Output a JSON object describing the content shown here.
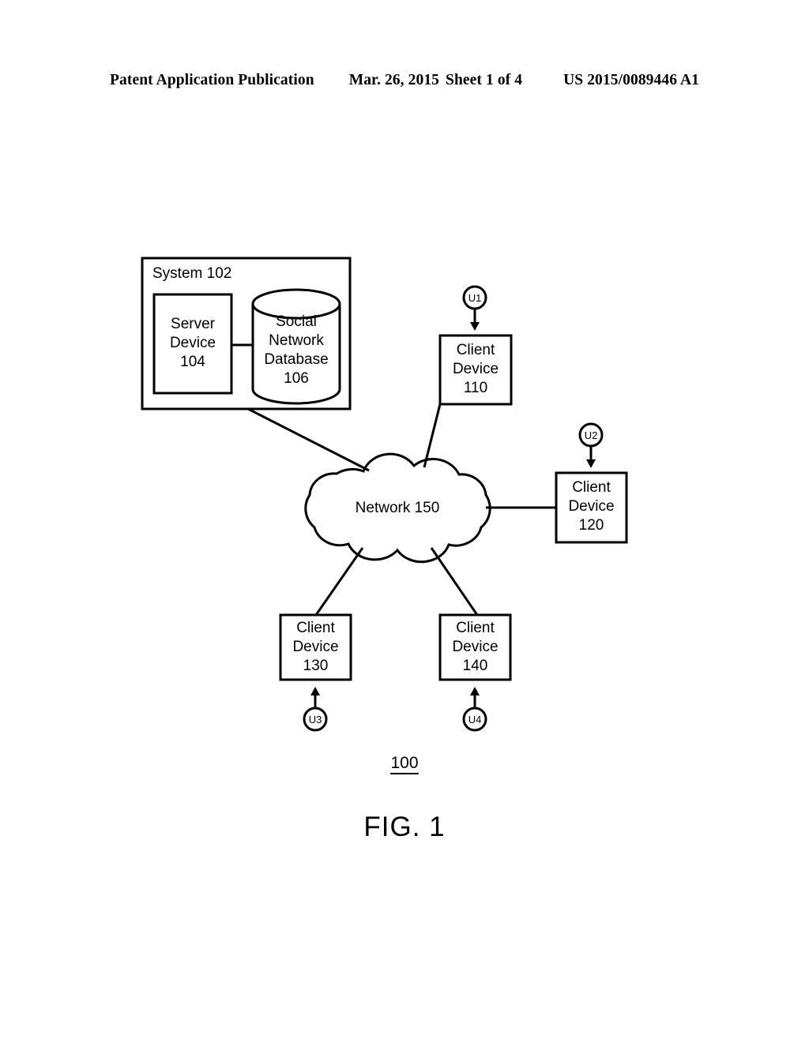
{
  "header": {
    "publication": "Patent Application Publication",
    "date": "Mar. 26, 2015",
    "sheet": "Sheet 1 of 4",
    "patent_number": "US 2015/0089446 A1"
  },
  "figure": {
    "number_label": "100",
    "caption": "FIG. 1",
    "system": {
      "title": "System 102",
      "server_device": "Server\nDevice\n104",
      "database": "Social\nNetwork\nDatabase\n106"
    },
    "network": {
      "label": "Network 150"
    },
    "clients": [
      {
        "id": "client-110",
        "label": "Client\nDevice\n110",
        "user": "U1"
      },
      {
        "id": "client-120",
        "label": "Client\nDevice\n120",
        "user": "U2"
      },
      {
        "id": "client-130",
        "label": "Client\nDevice\n130",
        "user": "U3"
      },
      {
        "id": "client-140",
        "label": "Client\nDevice\n140",
        "user": "U4"
      }
    ]
  },
  "colors": {
    "ink": "#000000",
    "paper": "#ffffff"
  }
}
